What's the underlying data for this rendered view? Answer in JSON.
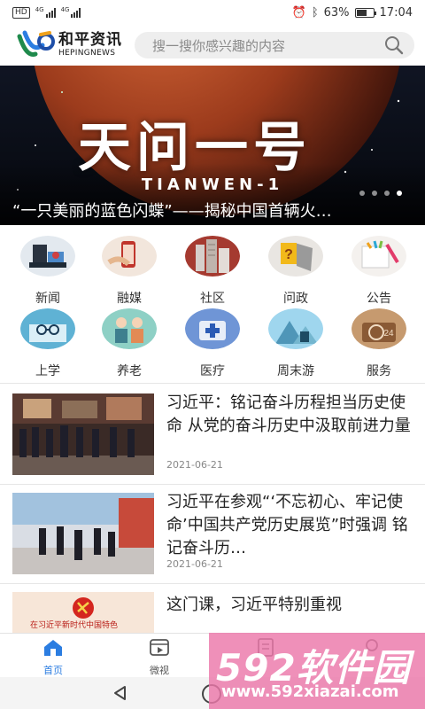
{
  "status_bar": {
    "hd": "HD",
    "net1": "4G",
    "net2": "4G",
    "battery_text": "63%",
    "battery_level": 0.63,
    "time": "17:04"
  },
  "header": {
    "logo_cn": "和平资讯",
    "logo_en": "HEPINGNEWS",
    "search_placeholder": "搜一搜你感兴趣的内容"
  },
  "banner": {
    "title": "天问一号",
    "subtitle": "TIANWEN-1",
    "caption": "“一只美丽的蓝色闪蝶”——揭秘中国首辆火…",
    "dots": 4,
    "active_dot": 3
  },
  "categories": [
    {
      "label": "新闻",
      "icon": "news-icon"
    },
    {
      "label": "融媒",
      "icon": "media-icon"
    },
    {
      "label": "社区",
      "icon": "community-icon"
    },
    {
      "label": "问政",
      "icon": "inquiry-icon"
    },
    {
      "label": "公告",
      "icon": "announcement-icon"
    },
    {
      "label": "上学",
      "icon": "school-icon"
    },
    {
      "label": "养老",
      "icon": "elderly-care-icon"
    },
    {
      "label": "医疗",
      "icon": "medical-icon"
    },
    {
      "label": "周末游",
      "icon": "weekend-travel-icon"
    },
    {
      "label": "服务",
      "icon": "service-icon"
    }
  ],
  "news": [
    {
      "title": "习近平：铭记奋斗历程担当历史使命 从党的奋斗历史中汲取前进力量",
      "date": "2021-06-21"
    },
    {
      "title": "习近平在参观“‘不忘初心、牢记使命’中国共产党历史展览”时强调 铭记奋斗历…",
      "date": "2021-06-21"
    },
    {
      "title": "这门课，习近平特别重视",
      "thumb_text": "在习近平新时代中国特色"
    }
  ],
  "tabs": [
    {
      "label": "首页",
      "icon": "home-icon"
    },
    {
      "label": "微视",
      "icon": "video-icon"
    },
    {
      "label": "",
      "icon": "document-icon"
    },
    {
      "label": "",
      "icon": "profile-icon"
    }
  ],
  "watermark": {
    "brand": "592软件园",
    "url": "www.592xiazai.com"
  },
  "colors": {
    "accent": "#2b7de1",
    "watermark": "#eb78aa"
  }
}
